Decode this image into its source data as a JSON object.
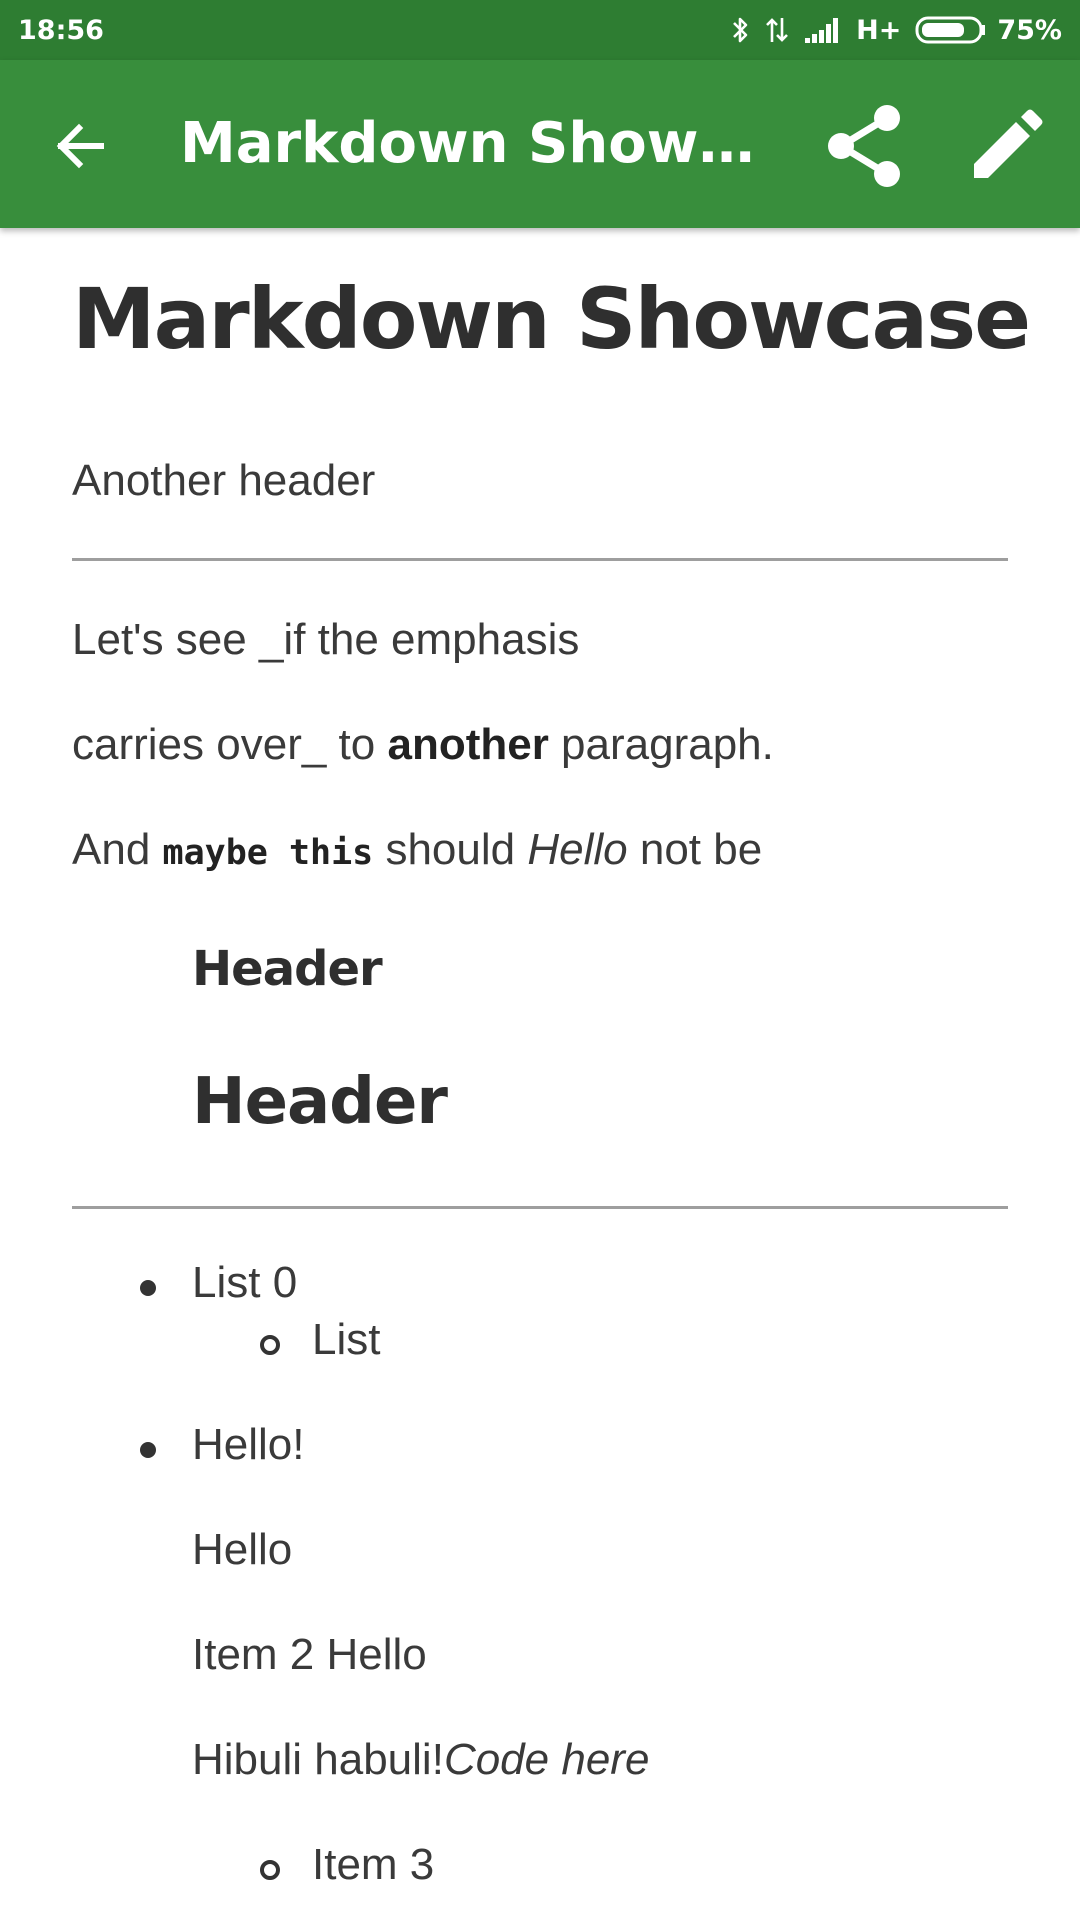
{
  "status_bar": {
    "time": "18:56",
    "network": "H+",
    "battery_percent": "75%",
    "battery_level": 0.75,
    "icons": [
      "bluetooth-icon",
      "data-transfer-icon",
      "signal-icon",
      "battery-icon"
    ]
  },
  "app_bar": {
    "title": "Markdown Showcase",
    "back_icon": "arrow-back-icon",
    "share_icon": "share-icon",
    "edit_icon": "pencil-icon",
    "color": "#388e3c",
    "status_color": "#2e7d32"
  },
  "document": {
    "h1": "Markdown Showcase",
    "subheader": "Another header",
    "para1": "Let's see _if the emphasis",
    "para2_before": "carries over_ to ",
    "para2_bold": "another",
    "para2_after": " paragraph.",
    "para3_before": "And ",
    "para3_code": "maybe this",
    "para3_mid": " should ",
    "para3_italic": "Hello",
    "para3_after": " not be",
    "h3": "Header",
    "h2": "Header",
    "list": {
      "item0": "List 0",
      "item0_sub": "List",
      "item1": "Hello!",
      "item1_p1": "Hello",
      "item1_p2": "Item 2 Hello",
      "item1_p3_before": "Hibuli habuli!",
      "item1_p3_italic": "Code here",
      "item1_sub": "Item 3"
    }
  }
}
